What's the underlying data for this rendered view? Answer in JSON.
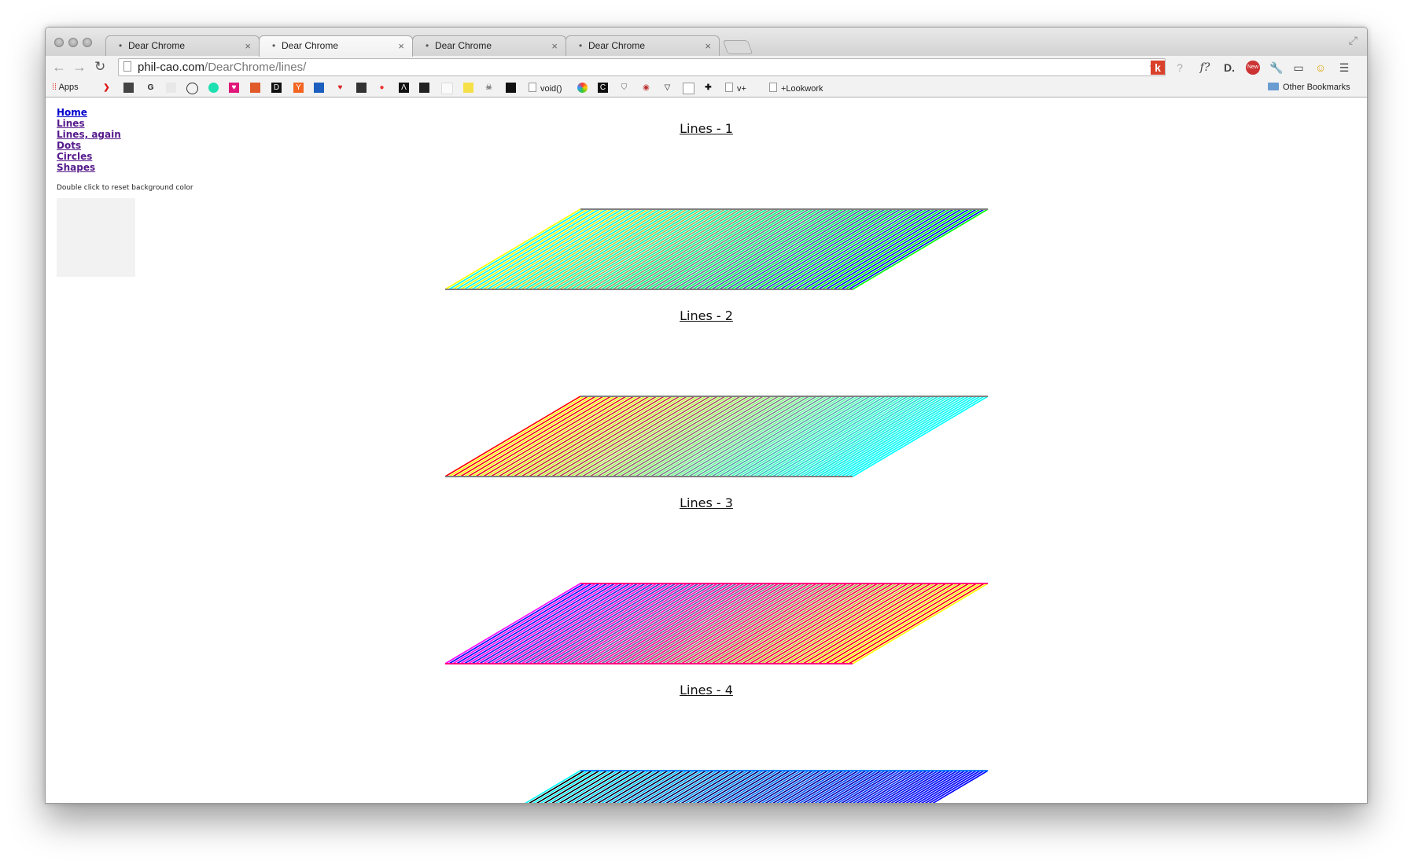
{
  "browser": {
    "tabs": [
      {
        "title": "Dear Chrome",
        "active": false
      },
      {
        "title": "Dear Chrome",
        "active": true
      },
      {
        "title": "Dear Chrome",
        "active": false
      },
      {
        "title": "Dear Chrome",
        "active": false
      }
    ],
    "url_host": "phil-cao.com",
    "url_path": "/DearChrome/lines/",
    "extensions": [
      "k",
      "?",
      "f?",
      "D.",
      "New",
      "wrench-icon",
      "cast-icon",
      "face-icon",
      "menu-icon"
    ],
    "bookmarks": {
      "apps_label": "Apps",
      "void_label": "void()",
      "vplus_label": "v+",
      "lookwork_label": "+Lookwork",
      "other_label": "Other Bookmarks"
    }
  },
  "page": {
    "nav": [
      {
        "label": "Home"
      },
      {
        "label": "Lines"
      },
      {
        "label": "Lines, again"
      },
      {
        "label": "Dots"
      },
      {
        "label": "Circles"
      },
      {
        "label": "Shapes"
      }
    ],
    "hint": "Double click to reset background color",
    "swatch_color": "#f2f2f2",
    "sections": [
      {
        "title": "Lines - 1",
        "colors": [
          "#ffff00",
          "#00ffff",
          "#0000ff",
          "#00ff00"
        ]
      },
      {
        "title": "Lines - 2",
        "colors": [
          "#ff0000",
          "#ffff00",
          "#00ffff",
          "#00ffff"
        ]
      },
      {
        "title": "Lines - 3",
        "colors": [
          "#ff00ff",
          "#0000ff",
          "#ff0000",
          "#ffff00"
        ]
      },
      {
        "title": "Lines - 4",
        "colors": [
          "#00ffff",
          "#000000",
          "#0000ff",
          "#0000ff"
        ]
      }
    ]
  }
}
